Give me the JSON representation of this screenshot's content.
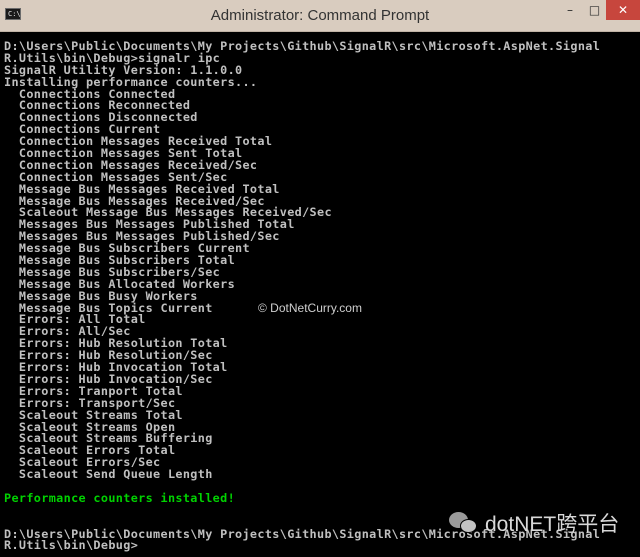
{
  "window": {
    "title": "Administrator: Command Prompt",
    "icon_text": "C:\\",
    "controls": {
      "minimize": "–",
      "maximize": "□",
      "close": "✕"
    }
  },
  "console": {
    "lines": [
      {
        "text": "D:\\Users\\Public\\Documents\\My Projects\\Github\\SignalR\\src\\Microsoft.AspNet.Signal",
        "color": "gray"
      },
      {
        "text": "R.Utils\\bin\\Debug>signalr ipc",
        "color": "gray"
      },
      {
        "text": "SignalR Utility Version: 1.1.0.0",
        "color": "gray"
      },
      {
        "text": "Installing performance counters...",
        "color": "gray"
      },
      {
        "text": "  Connections Connected",
        "color": "gray"
      },
      {
        "text": "  Connections Reconnected",
        "color": "gray"
      },
      {
        "text": "  Connections Disconnected",
        "color": "gray"
      },
      {
        "text": "  Connections Current",
        "color": "gray"
      },
      {
        "text": "  Connection Messages Received Total",
        "color": "gray"
      },
      {
        "text": "  Connection Messages Sent Total",
        "color": "gray"
      },
      {
        "text": "  Connection Messages Received/Sec",
        "color": "gray"
      },
      {
        "text": "  Connection Messages Sent/Sec",
        "color": "gray"
      },
      {
        "text": "  Message Bus Messages Received Total",
        "color": "gray"
      },
      {
        "text": "  Message Bus Messages Received/Sec",
        "color": "gray"
      },
      {
        "text": "  Scaleout Message Bus Messages Received/Sec",
        "color": "gray"
      },
      {
        "text": "  Messages Bus Messages Published Total",
        "color": "gray"
      },
      {
        "text": "  Messages Bus Messages Published/Sec",
        "color": "gray"
      },
      {
        "text": "  Message Bus Subscribers Current",
        "color": "gray"
      },
      {
        "text": "  Message Bus Subscribers Total",
        "color": "gray"
      },
      {
        "text": "  Message Bus Subscribers/Sec",
        "color": "gray"
      },
      {
        "text": "  Message Bus Allocated Workers",
        "color": "gray"
      },
      {
        "text": "  Message Bus Busy Workers",
        "color": "gray"
      },
      {
        "text": "  Message Bus Topics Current",
        "color": "gray"
      },
      {
        "text": "  Errors: All Total",
        "color": "gray"
      },
      {
        "text": "  Errors: All/Sec",
        "color": "gray"
      },
      {
        "text": "  Errors: Hub Resolution Total",
        "color": "gray"
      },
      {
        "text": "  Errors: Hub Resolution/Sec",
        "color": "gray"
      },
      {
        "text": "  Errors: Hub Invocation Total",
        "color": "gray"
      },
      {
        "text": "  Errors: Hub Invocation/Sec",
        "color": "gray"
      },
      {
        "text": "  Errors: Tranport Total",
        "color": "gray"
      },
      {
        "text": "  Errors: Transport/Sec",
        "color": "gray"
      },
      {
        "text": "  Scaleout Streams Total",
        "color": "gray"
      },
      {
        "text": "  Scaleout Streams Open",
        "color": "gray"
      },
      {
        "text": "  Scaleout Streams Buffering",
        "color": "gray"
      },
      {
        "text": "  Scaleout Errors Total",
        "color": "gray"
      },
      {
        "text": "  Scaleout Errors/Sec",
        "color": "gray"
      },
      {
        "text": "  Scaleout Send Queue Length",
        "color": "gray"
      },
      {
        "text": "",
        "color": "gray"
      },
      {
        "text": "Performance counters installed!",
        "color": "green"
      },
      {
        "text": "",
        "color": "gray"
      },
      {
        "text": "",
        "color": "gray"
      },
      {
        "text": "D:\\Users\\Public\\Documents\\My Projects\\Github\\SignalR\\src\\Microsoft.AspNet.Signal",
        "color": "gray"
      },
      {
        "text": "R.Utils\\bin\\Debug>",
        "color": "gray"
      }
    ]
  },
  "watermarks": {
    "center": "© DotNetCurry.com",
    "corner": "dotNET跨平台"
  },
  "colors": {
    "titlebar": "#d9ccbf",
    "console_bg": "#000000",
    "text_gray": "#c0c0c0",
    "text_green": "#00d200",
    "close_button": "#c7463d"
  }
}
